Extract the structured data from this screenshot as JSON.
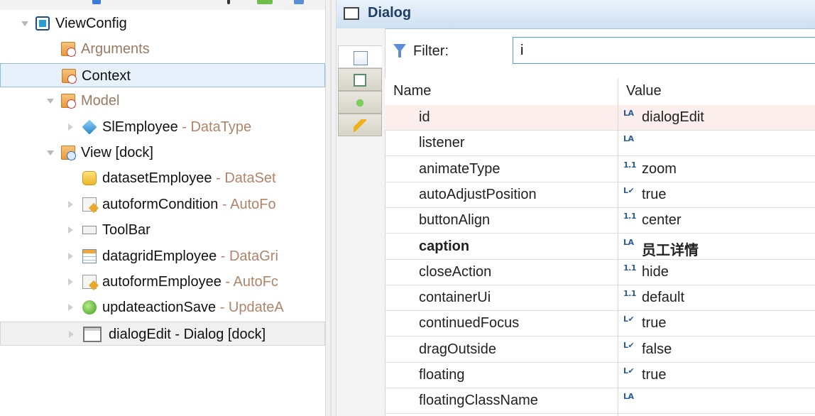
{
  "tree": {
    "nodes": [
      {
        "name": "ViewConfig",
        "type": "",
        "icon": "view-config-icon",
        "kind": "view",
        "indent": 0,
        "twisty": "expanded",
        "dim": false,
        "state": ""
      },
      {
        "name": "Arguments",
        "type": "",
        "icon": "arguments-folder-icon",
        "kind": "folder-red",
        "indent": 1,
        "twisty": "",
        "dim": true,
        "state": ""
      },
      {
        "name": "Context",
        "type": "",
        "icon": "context-folder-icon",
        "kind": "folder-red",
        "indent": 1,
        "twisty": "",
        "dim": false,
        "state": "selected"
      },
      {
        "name": "Model",
        "type": "",
        "icon": "model-folder-icon",
        "kind": "folder-red",
        "indent": 1,
        "twisty": "expanded",
        "dim": true,
        "state": ""
      },
      {
        "name": "SlEmployee",
        "type": " - DataType",
        "icon": "datatype-cube-icon",
        "kind": "cube",
        "indent": 2,
        "twisty": "collapsed",
        "dim": false,
        "state": ""
      },
      {
        "name": "View [dock]",
        "type": "",
        "icon": "view-folder-icon",
        "kind": "folder-blue",
        "indent": 1,
        "twisty": "expanded",
        "dim": false,
        "state": ""
      },
      {
        "name": "datasetEmployee",
        "type": " - DataSet",
        "icon": "dataset-icon",
        "kind": "dataset",
        "indent": 2,
        "twisty": "",
        "dim": false,
        "state": ""
      },
      {
        "name": "autoformCondition",
        "type": " - AutoFo",
        "icon": "autoform-icon",
        "kind": "form",
        "indent": 2,
        "twisty": "collapsed",
        "dim": false,
        "state": ""
      },
      {
        "name": "ToolBar",
        "type": "",
        "icon": "toolbar-icon",
        "kind": "toolbar",
        "indent": 2,
        "twisty": "collapsed",
        "dim": false,
        "state": ""
      },
      {
        "name": "datagridEmployee",
        "type": " - DataGri",
        "icon": "datagrid-icon",
        "kind": "grid",
        "indent": 2,
        "twisty": "collapsed",
        "dim": false,
        "state": ""
      },
      {
        "name": "autoformEmployee",
        "type": " - AutoFc",
        "icon": "autoform-icon",
        "kind": "form",
        "indent": 2,
        "twisty": "collapsed",
        "dim": false,
        "state": ""
      },
      {
        "name": "updateactionSave",
        "type": " - UpdateA",
        "icon": "update-action-icon",
        "kind": "action",
        "indent": 2,
        "twisty": "collapsed",
        "dim": false,
        "state": ""
      },
      {
        "name": "dialogEdit - Dialog [dock]",
        "type": "",
        "icon": "dialog-icon",
        "kind": "dialog",
        "indent": 2,
        "twisty": "collapsed",
        "dim": false,
        "state": "hover"
      }
    ]
  },
  "panel": {
    "title": "Dialog",
    "filter": {
      "label": "Filter:",
      "value": "i"
    },
    "columns": {
      "name": "Name",
      "value": "Value"
    },
    "side_tabs": [
      {
        "icon": "properties-edit-icon",
        "active": true
      },
      {
        "icon": "layout-icon",
        "active": false
      },
      {
        "icon": "pin-icon",
        "active": false
      },
      {
        "icon": "events-lightning-icon",
        "active": false
      }
    ],
    "properties": [
      {
        "name": "id",
        "type": "LA",
        "value": "dialogEdit",
        "bold": false,
        "selected": true
      },
      {
        "name": "listener",
        "type": "LA",
        "value": "",
        "bold": false,
        "selected": false
      },
      {
        "name": "animateType",
        "type": "1.1",
        "value": "zoom",
        "bold": false,
        "selected": false
      },
      {
        "name": "autoAdjustPosition",
        "type": "L✔",
        "value": "true",
        "bold": false,
        "selected": false
      },
      {
        "name": "buttonAlign",
        "type": "1.1",
        "value": "center",
        "bold": false,
        "selected": false
      },
      {
        "name": "caption",
        "type": "LA",
        "value": "员工详情",
        "bold": true,
        "selected": false
      },
      {
        "name": "closeAction",
        "type": "1.1",
        "value": "hide",
        "bold": false,
        "selected": false
      },
      {
        "name": "containerUi",
        "type": "1.1",
        "value": "default",
        "bold": false,
        "selected": false
      },
      {
        "name": "continuedFocus",
        "type": "L✔",
        "value": "true",
        "bold": false,
        "selected": false
      },
      {
        "name": "dragOutside",
        "type": "L✔",
        "value": "false",
        "bold": false,
        "selected": false
      },
      {
        "name": "floating",
        "type": "L✔",
        "value": "true",
        "bold": false,
        "selected": false
      },
      {
        "name": "floatingClassName",
        "type": "LA",
        "value": "",
        "bold": false,
        "selected": false
      }
    ]
  },
  "colors": {
    "selection": "#e6f1fb",
    "header": "#cfe0f1",
    "type_text": "#b08468",
    "selected_row": "#fdeeee"
  }
}
